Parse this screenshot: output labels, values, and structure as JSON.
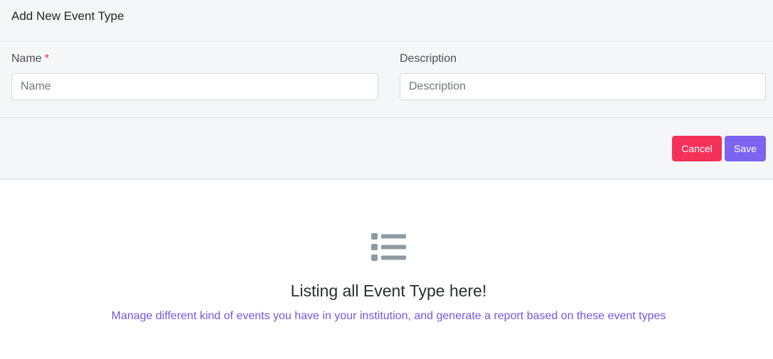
{
  "form": {
    "title": "Add New Event Type",
    "name_label": "Name",
    "required_mark": "*",
    "name_placeholder": "Name",
    "name_value": "",
    "description_label": "Description",
    "description_placeholder": "Description",
    "description_value": ""
  },
  "actions": {
    "cancel_label": "Cancel",
    "save_label": "Save"
  },
  "empty_state": {
    "icon": "list-icon",
    "title": "Listing all Event Type here!",
    "subtitle": "Manage different kind of events you have in your institution, and generate a report based on these event types"
  },
  "colors": {
    "cancel": "#f5315a",
    "save": "#7c63f0",
    "subtitle": "#7357e0",
    "icon": "#8e9aa3"
  }
}
